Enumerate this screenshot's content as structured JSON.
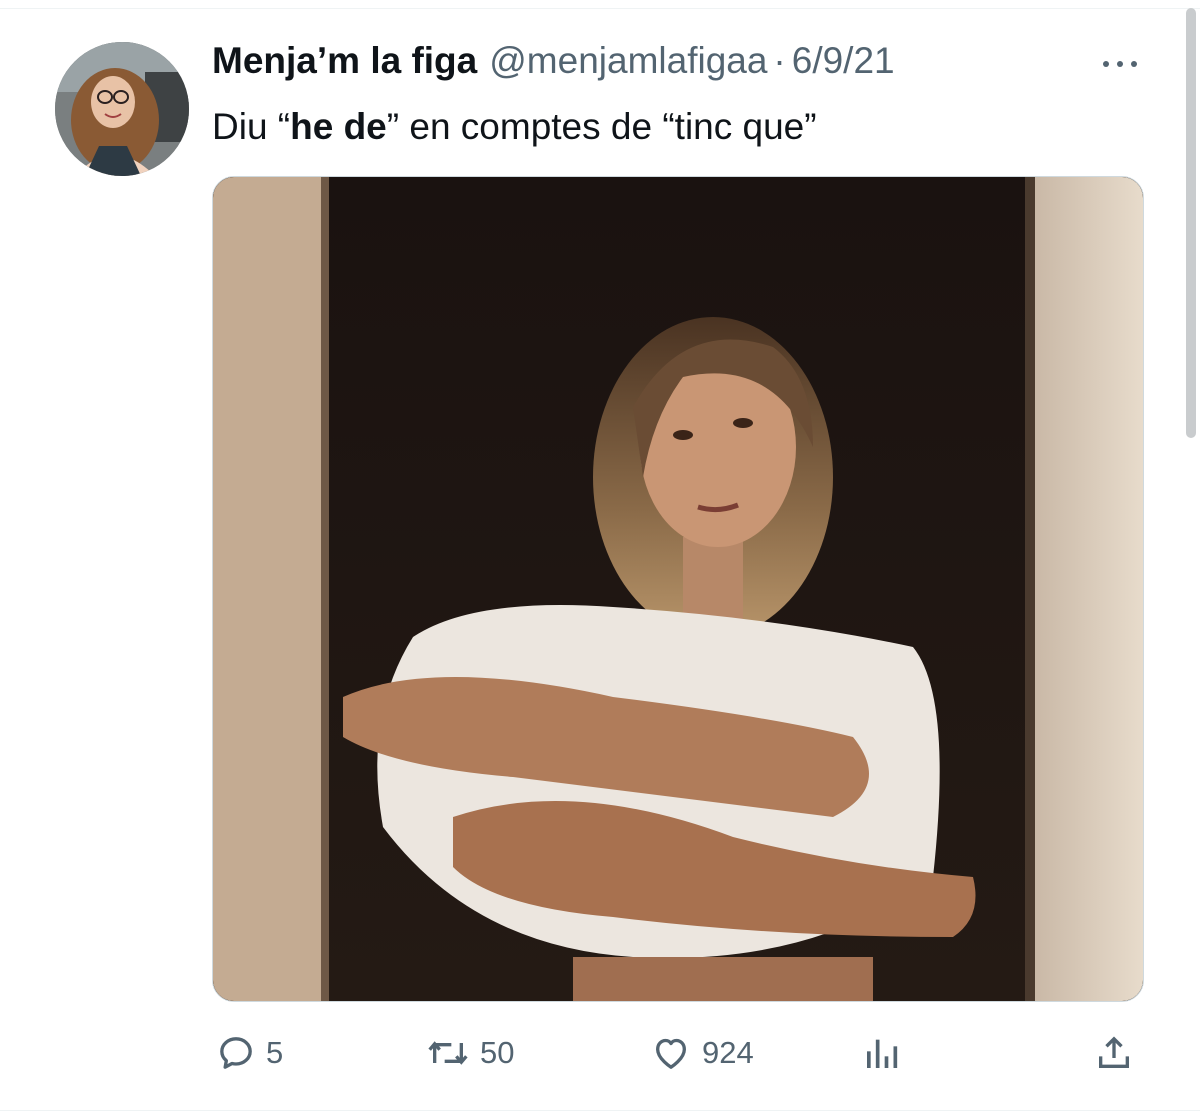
{
  "tweet": {
    "display_name": "Menja’m la figa",
    "handle": "@menjamlafigaa",
    "separator": "·",
    "date": "6/9/21",
    "text": {
      "part1": "Diu “",
      "bold": "he de",
      "part2": "” en comptes de “tinc que”"
    }
  },
  "actions": {
    "replies": "5",
    "retweets": "50",
    "likes": "924"
  },
  "icons": {
    "more": "more-dots-icon",
    "reply": "reply-bubble-icon",
    "retweet": "retweet-arrows-icon",
    "like": "heart-icon",
    "views": "bar-chart-icon",
    "share": "share-upload-icon"
  },
  "colors": {
    "text_primary": "#0f1419",
    "text_secondary": "#536471",
    "divider": "#eff3f4"
  }
}
